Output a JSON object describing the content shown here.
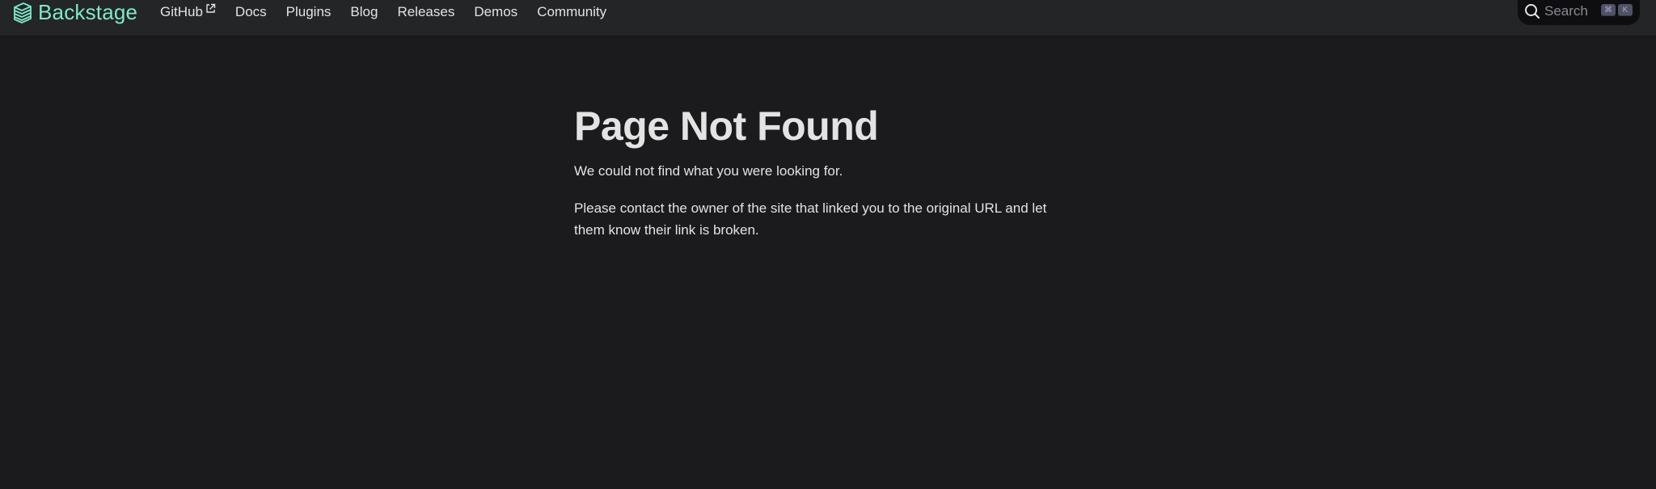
{
  "navbar": {
    "brand": {
      "title": "Backstage",
      "logo_icon": "backstage-stack-icon",
      "color": "#7ee8cb"
    },
    "items": [
      {
        "label": "GitHub",
        "external": true
      },
      {
        "label": "Docs"
      },
      {
        "label": "Plugins"
      },
      {
        "label": "Blog"
      },
      {
        "label": "Releases"
      },
      {
        "label": "Demos"
      },
      {
        "label": "Community"
      }
    ],
    "search": {
      "placeholder": "Search",
      "icon": "search-icon",
      "shortcut_keys": [
        "⌘",
        "K"
      ]
    }
  },
  "main": {
    "title": "Page Not Found",
    "paragraphs": [
      "We could not find what you were looking for.",
      "Please contact the owner of the site that linked you to the original URL and let them know their link is broken."
    ]
  },
  "colors": {
    "background": "#1b1b1d",
    "navbar": "#242526",
    "text": "#e3e3e3",
    "accent": "#7ee8cb"
  }
}
